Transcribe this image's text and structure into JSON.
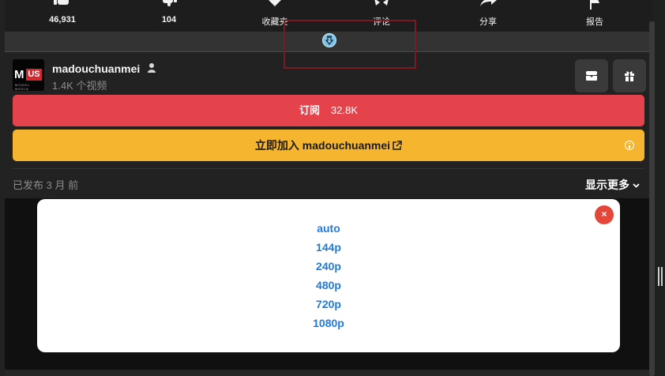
{
  "action_bar": {
    "like_count": "46,931",
    "dislike_count": "104",
    "favorites_label": "收藏夹",
    "comments_label": "评论",
    "share_label": "分享",
    "report_label": "报告"
  },
  "channel": {
    "avatar": {
      "logo_text_main": "M",
      "logo_text_badge": "US",
      "logo_subtext": "MODEL MEDIA"
    },
    "name": "madouchuanmei",
    "video_count": "1.4K 个视频"
  },
  "subscribe": {
    "label": "订阅",
    "count": "32.8K"
  },
  "join": {
    "label": "立即加入 madouchuanmei"
  },
  "meta": {
    "published": "已发布 3 月 前",
    "show_more": "显示更多"
  },
  "quality_modal": {
    "options": [
      "auto",
      "144p",
      "240p",
      "480p",
      "720p",
      "1080p"
    ],
    "close_label": "×"
  },
  "colors": {
    "subscribe_red": "#e5434b",
    "join_yellow": "#f5b52e",
    "quality_blue": "#1f7be0",
    "close_red": "#e4473a",
    "collapse_blue": "#7cc4ea"
  }
}
